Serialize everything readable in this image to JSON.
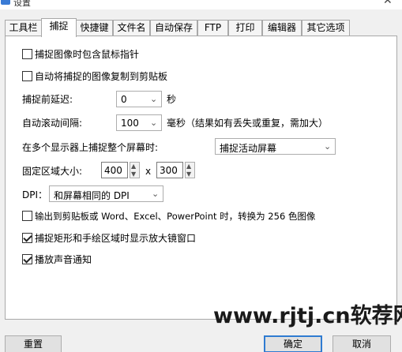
{
  "window": {
    "title": "设置",
    "close_icon": "close-icon"
  },
  "tabs": [
    {
      "label": "工具栏"
    },
    {
      "label": "捕捉",
      "active": true
    },
    {
      "label": "快捷键"
    },
    {
      "label": "文件名"
    },
    {
      "label": "自动保存"
    },
    {
      "label": "FTP"
    },
    {
      "label": "打印"
    },
    {
      "label": "编辑器"
    },
    {
      "label": "其它选项"
    }
  ],
  "capture": {
    "include_cursor": {
      "label": "捕捉图像时包含鼠标指针",
      "checked": false
    },
    "copy_to_clipboard": {
      "label": "自动将捕捉的图像复制到剪贴板",
      "checked": false
    },
    "delay": {
      "label": "捕捉前延迟:",
      "value": "0",
      "unit": "秒"
    },
    "scroll_interval": {
      "label": "自动滚动间隔:",
      "value": "100",
      "unit": "毫秒（结果如有丢失或重复，需加大）"
    },
    "multi_monitor": {
      "label": "在多个显示器上捕捉整个屏幕时:",
      "value": "捕捉活动屏幕"
    },
    "fixed_region": {
      "label": "固定区域大小:",
      "width": "400",
      "separator": "x",
      "height": "300"
    },
    "dpi": {
      "label": "DPI：",
      "value": "和屏幕相同的 DPI"
    },
    "convert_256": {
      "label": "输出到剪贴板或 Word、Excel、PowerPoint 时，转换为 256 色图像",
      "checked": false
    },
    "magnifier": {
      "label": "捕捉矩形和手绘区域时显示放大镜窗口",
      "checked": true
    },
    "sound": {
      "label": "播放声音通知",
      "checked": true
    }
  },
  "watermark": "www.rjtj.cn软荐网",
  "buttons": {
    "reset": "重置",
    "ok": "确定",
    "cancel": "取消"
  }
}
